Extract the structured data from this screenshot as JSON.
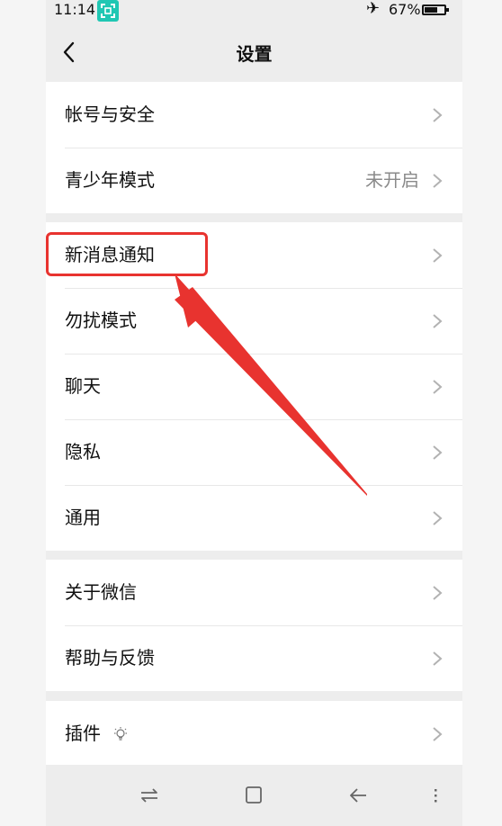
{
  "status_bar": {
    "time": "11:14",
    "app_icon": "scan-frame-icon",
    "airplane_icon": "airplane-icon",
    "battery_percent": "67%",
    "battery_level": 0.67
  },
  "nav": {
    "back_icon": "chevron-left-icon",
    "title": "设置"
  },
  "groups": [
    {
      "items": [
        {
          "label": "帐号与安全",
          "value": ""
        },
        {
          "label": "青少年模式",
          "value": "未开启"
        }
      ]
    },
    {
      "items": [
        {
          "label": "新消息通知",
          "value": ""
        },
        {
          "label": "勿扰模式",
          "value": ""
        },
        {
          "label": "聊天",
          "value": ""
        },
        {
          "label": "隐私",
          "value": ""
        },
        {
          "label": "通用",
          "value": ""
        }
      ]
    },
    {
      "items": [
        {
          "label": "关于微信",
          "value": ""
        },
        {
          "label": "帮助与反馈",
          "value": ""
        }
      ]
    },
    {
      "items": [
        {
          "label": "插件",
          "value": "",
          "icon": "lightbulb-icon"
        }
      ]
    }
  ],
  "annotation": {
    "highlight_color": "#e8332f",
    "target": "新消息通知"
  },
  "bottom_nav": [
    "switch-apps-icon",
    "home-square-icon",
    "back-arrow-icon",
    "menu-dots-icon"
  ],
  "colors": {
    "background": "#ededed",
    "list_bg": "#ffffff",
    "secondary_text": "#8a8a8a",
    "chevron": "#b2b2b2"
  }
}
